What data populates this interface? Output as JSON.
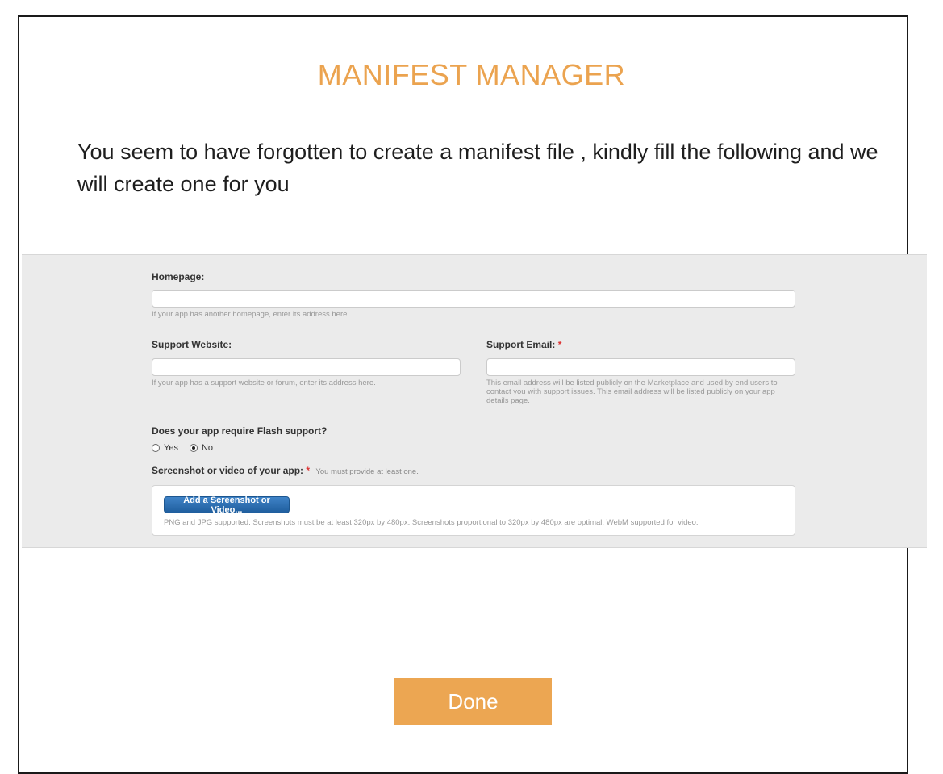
{
  "header": {
    "title": "MANIFEST MANAGER",
    "intro": "You seem to have forgotten to create a manifest file , kindly fill the following and we will create one for you"
  },
  "form": {
    "homepage": {
      "label": "Homepage:",
      "value": "",
      "help": "If your app has another homepage, enter its address here."
    },
    "support_website": {
      "label": "Support Website:",
      "value": "",
      "help": "If your app has a support website or forum, enter its address here."
    },
    "support_email": {
      "label": "Support Email:",
      "required_mark": "*",
      "value": "",
      "help": "This email address will be listed publicly on the Marketplace and used by end users to contact you with support issues. This email address will be listed publicly on your app details page."
    },
    "flash": {
      "question": "Does your app require Flash support?",
      "options": [
        "Yes",
        "No"
      ],
      "selected": "No"
    },
    "media": {
      "label": "Screenshot or video of your app:",
      "required_mark": "*",
      "note": "You must provide at least one.",
      "button_label": "Add a Screenshot or Video...",
      "help": "PNG and JPG supported. Screenshots must be at least 320px by 480px. Screenshots proportional to 320px by 480px are optimal. WebM supported for video."
    }
  },
  "done_label": "Done",
  "colors": {
    "accent": "#eba34f",
    "button_blue": "#2b6cb0",
    "required": "#dd3333"
  }
}
